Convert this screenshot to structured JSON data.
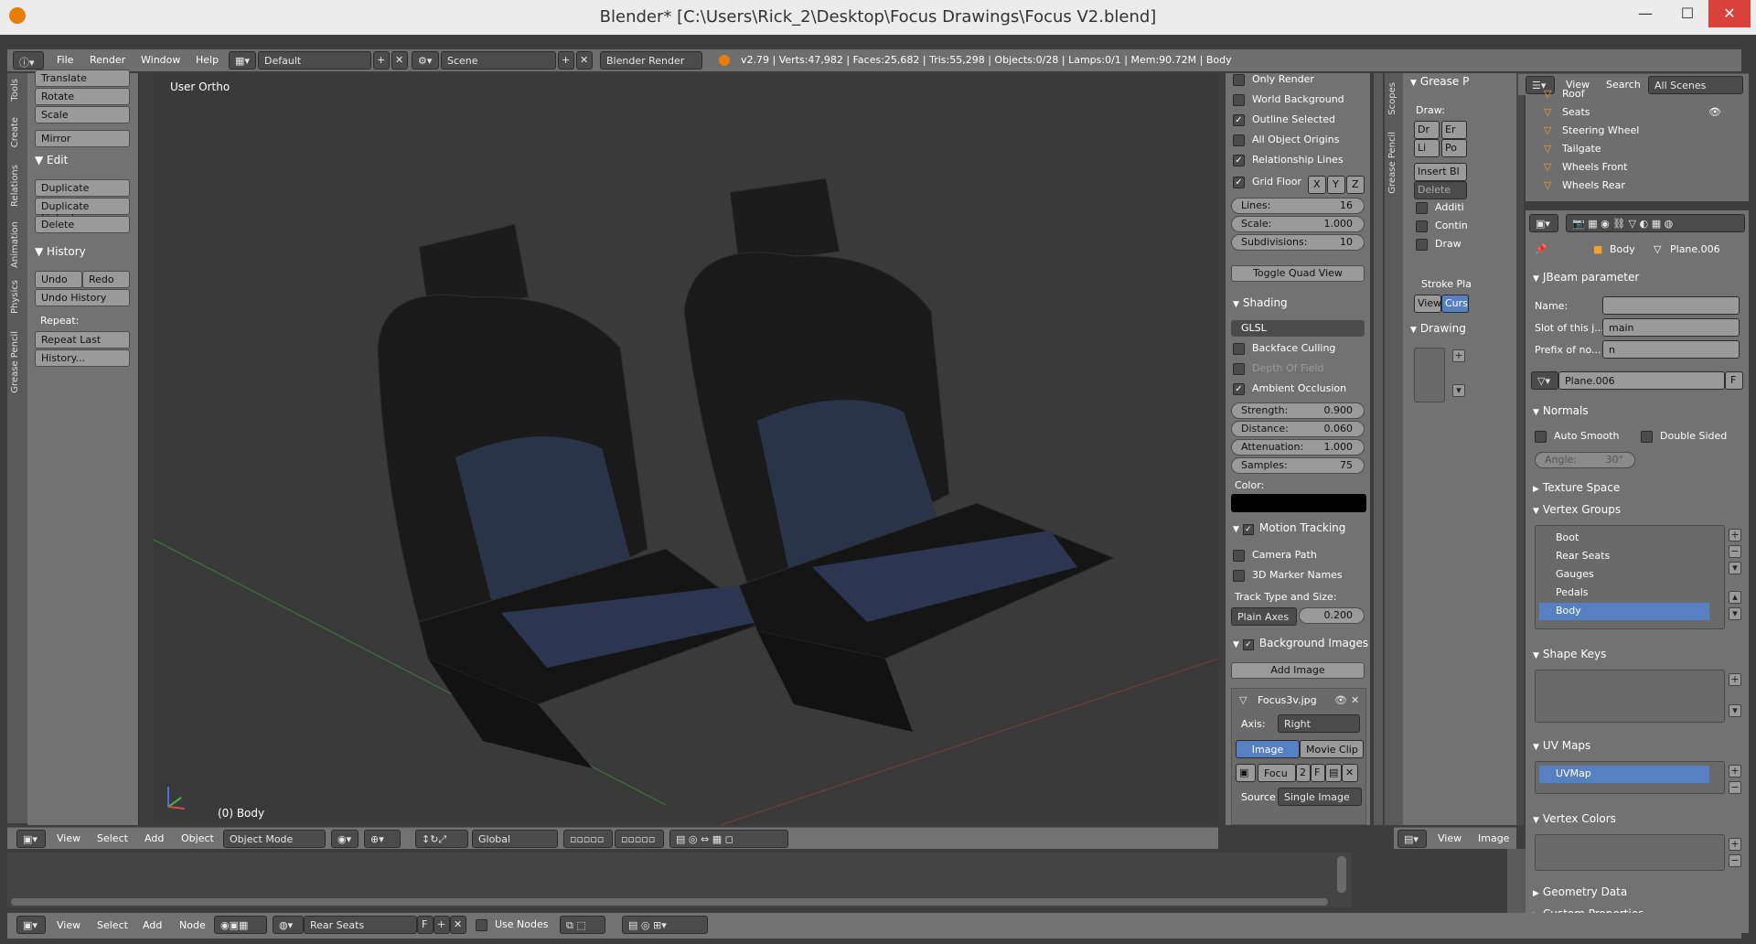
{
  "window": {
    "title": "Blender* [C:\\Users\\Rick_2\\Desktop\\Focus Drawings\\Focus V2.blend]",
    "minimize": "—",
    "maximize": "☐",
    "close": "✕"
  },
  "topbar": {
    "menus": [
      "File",
      "Render",
      "Window",
      "Help"
    ],
    "layout": "Default",
    "scene": "Scene",
    "engine": "Blender Render",
    "stats": "v2.79 | Verts:47,982 | Faces:25,682 | Tris:55,298 | Objects:0/28 | Lamps:0/1 | Mem:90.72M | Body"
  },
  "tool_tabs": [
    "Tools",
    "Create",
    "Relations",
    "Animation",
    "Physics",
    "Grease Pencil"
  ],
  "tool_shelf": {
    "transform_buttons": [
      "Translate",
      "Rotate",
      "Scale"
    ],
    "mirror": "Mirror",
    "edit_header": "Edit",
    "edit_buttons": [
      "Duplicate",
      "Duplicate Linked",
      "Delete"
    ],
    "history_header": "History",
    "undo": "Undo",
    "redo": "Redo",
    "undo_history": "Undo History",
    "repeat_label": "Repeat:",
    "repeat_last": "Repeat Last",
    "history_btn": "History..."
  },
  "viewport": {
    "view_label": "User Ortho",
    "object_label": "(0) Body",
    "header_menus": [
      "View",
      "Select",
      "Add",
      "Object"
    ],
    "mode": "Object Mode",
    "orientation": "Global"
  },
  "npanel": {
    "only_render": "Only Render",
    "world_background": "World Background",
    "outline_selected": "Outline Selected",
    "all_object_origins": "All Object Origins",
    "relationship_lines": "Relationship Lines",
    "grid_floor": "Grid Floor",
    "axes": [
      "X",
      "Y",
      "Z"
    ],
    "lines_label": "Lines:",
    "lines_value": "16",
    "scale_label": "Scale:",
    "scale_value": "1.000",
    "subdiv_label": "Subdivisions:",
    "subdiv_value": "10",
    "toggle_quad": "Toggle Quad View",
    "shading_header": "Shading",
    "shading_mode": "GLSL",
    "backface": "Backface Culling",
    "dof": "Depth Of Field",
    "ao": "Ambient Occlusion",
    "strength_label": "Strength:",
    "strength_value": "0.900",
    "distance_label": "Distance:",
    "distance_value": "0.060",
    "attenuation_label": "Attenuation:",
    "attenuation_value": "1.000",
    "samples_label": "Samples:",
    "samples_value": "75",
    "color_label": "Color:",
    "ao_color": "#000000",
    "motion_header": "Motion Tracking",
    "camera_path": "Camera Path",
    "marker_names": "3D Marker Names",
    "track_type_label": "Track Type and Size:",
    "track_type": "Plain Axes",
    "track_size": "0.200",
    "bg_header": "Background Images",
    "add_image": "Add Image",
    "image_name": "Focus3v.jpg",
    "axis_label": "Axis:",
    "axis_value": "Right",
    "tab_image": "Image",
    "tab_clip": "Movie Clip",
    "img_field": "Focu",
    "img_users": "2",
    "img_f": "F",
    "source_label": "Source",
    "source_value": "Single Image"
  },
  "gpanel": {
    "tabs": [
      "Scopes",
      "Grease Pencil"
    ],
    "header": "Grease P",
    "draw_label": "Draw:",
    "tools": [
      "Dr",
      "Er",
      "Li",
      "Po"
    ],
    "insert": "Insert Bl",
    "delete": "Delete",
    "opts": [
      "Additi",
      "Contin",
      "Draw"
    ],
    "stroke_label": "Stroke Pla",
    "view_btn": "View",
    "cursor_btn": "Curso",
    "drawing_header": "Drawing",
    "footer_menus": [
      "View",
      "Image"
    ]
  },
  "outliner": {
    "menus": [
      "View",
      "Search"
    ],
    "filter": "All Scenes",
    "rows": [
      "Roof",
      "Seats",
      "Steering Wheel",
      "Tailgate",
      "Wheels Front",
      "Wheels Rear"
    ]
  },
  "properties": {
    "breadcrumb_obj": "Body",
    "breadcrumb_data": "Plane.006",
    "jbeam_header": "JBeam parameter",
    "name_label": "Name:",
    "name_value": "",
    "slot_label": "Slot of this j...",
    "slot_value": "main",
    "prefix_label": "Prefix of no...",
    "prefix_value": "n",
    "mesh_name": "Plane.006",
    "mesh_f": "F",
    "normals_header": "Normals",
    "auto_smooth": "Auto Smooth",
    "double_sided": "Double Sided",
    "angle_label": "Angle:",
    "angle_value": "30°",
    "texture_space": "Texture Space",
    "vgroups_header": "Vertex Groups",
    "vgroups": [
      "Boot",
      "Rear Seats",
      "Gauges",
      "Pedals",
      "Body"
    ],
    "shape_keys": "Shape Keys",
    "uv_maps": "UV Maps",
    "uv_item": "UVMap",
    "vertex_colors": "Vertex Colors",
    "geometry_data": "Geometry Data",
    "custom_props": "Custom Properties"
  },
  "node_editor": {
    "menus": [
      "View",
      "Select",
      "Add",
      "Node"
    ],
    "material": "Rear Seats",
    "f": "F",
    "use_nodes": "Use Nodes"
  }
}
